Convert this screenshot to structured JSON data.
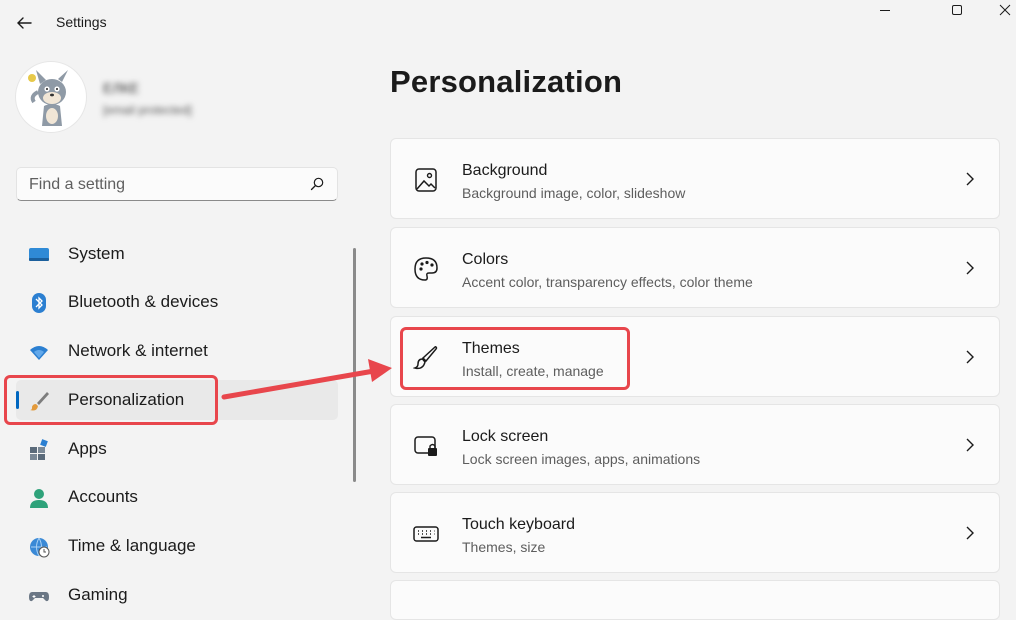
{
  "window": {
    "title": "Settings"
  },
  "user": {
    "name": "ЕЛКЕ",
    "email": "[email protected]"
  },
  "search": {
    "placeholder": "Find a setting",
    "value": ""
  },
  "sidebar": {
    "items": [
      {
        "label": "System",
        "icon": "system-monitor-icon"
      },
      {
        "label": "Bluetooth & devices",
        "icon": "bluetooth-icon"
      },
      {
        "label": "Network & internet",
        "icon": "wifi-icon"
      },
      {
        "label": "Personalization",
        "icon": "paintbrush-icon",
        "selected": true
      },
      {
        "label": "Apps",
        "icon": "apps-icon"
      },
      {
        "label": "Accounts",
        "icon": "person-icon"
      },
      {
        "label": "Time & language",
        "icon": "globe-clock-icon"
      },
      {
        "label": "Gaming",
        "icon": "gamepad-icon"
      }
    ]
  },
  "main": {
    "title": "Personalization",
    "cards": [
      {
        "title": "Background",
        "subtitle": "Background image, color, slideshow",
        "icon": "image-icon"
      },
      {
        "title": "Colors",
        "subtitle": "Accent color, transparency effects, color theme",
        "icon": "palette-icon"
      },
      {
        "title": "Themes",
        "subtitle": "Install, create, manage",
        "icon": "brush-icon"
      },
      {
        "title": "Lock screen",
        "subtitle": "Lock screen images, apps, animations",
        "icon": "lock-screen-icon"
      },
      {
        "title": "Touch keyboard",
        "subtitle": "Themes, size",
        "icon": "keyboard-icon"
      }
    ]
  },
  "colors": {
    "accent": "#0067c0",
    "highlight": "#e8464c",
    "background": "#f3f3f3"
  }
}
